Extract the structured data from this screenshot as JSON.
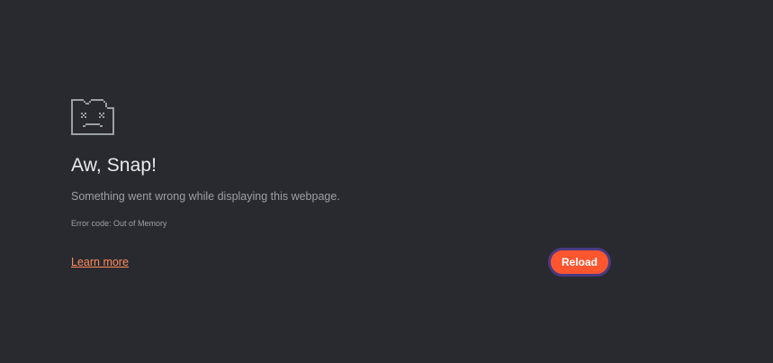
{
  "error_page": {
    "icon": "sad-tab-icon",
    "title": "Aw, Snap!",
    "message": "Something went wrong while displaying this webpage.",
    "error_code": "Error code: Out of Memory",
    "learn_more_label": "Learn more",
    "reload_label": "Reload"
  },
  "colors": {
    "background": "#292a2f",
    "title": "#e8eaed",
    "secondary_text": "#9aa0a6",
    "link": "#ff8a5c",
    "button": "#ff5630",
    "button_focus_ring": "#4b3a82",
    "icon": "#9aa0a6"
  }
}
